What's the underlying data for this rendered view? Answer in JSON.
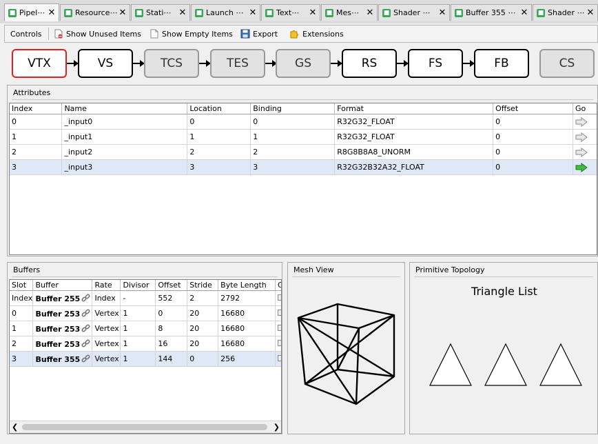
{
  "tabs": [
    {
      "label": "Pipel⋯"
    },
    {
      "label": "Resource⋯"
    },
    {
      "label": "Stati⋯"
    },
    {
      "label": "Launch ⋯"
    },
    {
      "label": "Text⋯"
    },
    {
      "label": "Mes⋯"
    },
    {
      "label": "Shader ⋯"
    },
    {
      "label": "Buffer 355 ⋯"
    },
    {
      "label": "Shader ⋯"
    }
  ],
  "tab_close_glyph": "✕",
  "toolbar": {
    "controls": "Controls",
    "show_unused": "Show Unused Items",
    "show_empty": "Show Empty Items",
    "export": "Export",
    "extensions": "Extensions"
  },
  "pipeline": {
    "stages": [
      "VTX",
      "VS",
      "TCS",
      "TES",
      "GS",
      "RS",
      "FS",
      "FB",
      "CS"
    ],
    "selected": "VTX",
    "inactive": [
      "TCS",
      "TES",
      "GS",
      "CS"
    ]
  },
  "attributes": {
    "title": "Attributes",
    "columns": [
      "Index",
      "Name",
      "Location",
      "Binding",
      "Format",
      "Offset",
      "Go"
    ],
    "rows": [
      {
        "index": "0",
        "name": "_input0",
        "location": "0",
        "binding": "0",
        "format": "R32G32_FLOAT",
        "offset": "0"
      },
      {
        "index": "1",
        "name": "_input1",
        "location": "1",
        "binding": "1",
        "format": "R32G32_FLOAT",
        "offset": "0"
      },
      {
        "index": "2",
        "name": "_input2",
        "location": "2",
        "binding": "2",
        "format": "R8G8B8A8_UNORM",
        "offset": "0"
      },
      {
        "index": "3",
        "name": "_input3",
        "location": "3",
        "binding": "3",
        "format": "R32G32B32A32_FLOAT",
        "offset": "0"
      }
    ],
    "selected_row": 3
  },
  "buffers": {
    "title": "Buffers",
    "columns": [
      "Slot",
      "Buffer",
      "Rate",
      "Divisor",
      "Offset",
      "Stride",
      "Byte Length",
      "G"
    ],
    "rows": [
      {
        "slot": "Index",
        "buffer": "Buffer 255",
        "rate": "Index",
        "divisor": "-",
        "offset": "552",
        "stride": "2",
        "length": "2792"
      },
      {
        "slot": "0",
        "buffer": "Buffer 253",
        "rate": "Vertex",
        "divisor": "1",
        "offset": "0",
        "stride": "20",
        "length": "16680"
      },
      {
        "slot": "1",
        "buffer": "Buffer 253",
        "rate": "Vertex",
        "divisor": "1",
        "offset": "8",
        "stride": "20",
        "length": "16680"
      },
      {
        "slot": "2",
        "buffer": "Buffer 253",
        "rate": "Vertex",
        "divisor": "1",
        "offset": "16",
        "stride": "20",
        "length": "16680"
      },
      {
        "slot": "3",
        "buffer": "Buffer 355",
        "rate": "Vertex",
        "divisor": "1",
        "offset": "144",
        "stride": "0",
        "length": "256"
      }
    ],
    "selected_row": 4
  },
  "mesh_view": {
    "title": "Mesh View"
  },
  "topology": {
    "title": "Primitive Topology",
    "value": "Triangle List"
  },
  "colors": {
    "selected_stage_border": "#e02020",
    "selected_row": "#dfe8f6",
    "go_active": "#3cbf3c",
    "tab_icon": "#3aa65b"
  }
}
